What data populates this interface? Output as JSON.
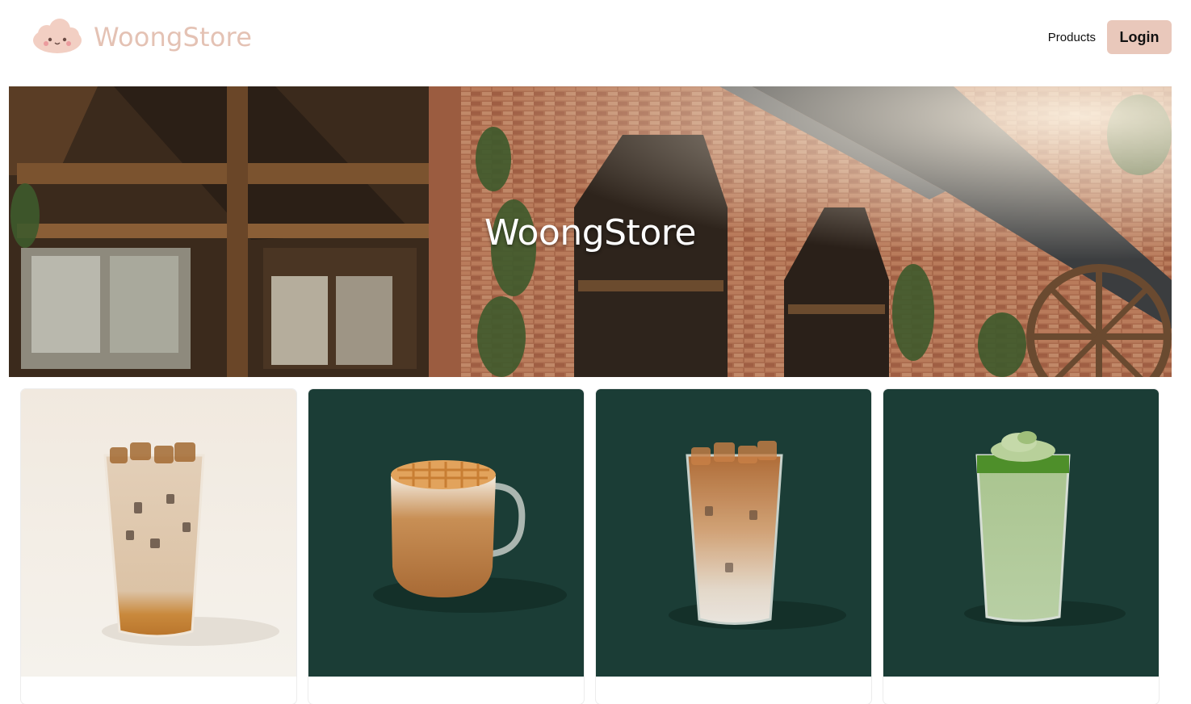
{
  "header": {
    "brand": "WoongStore",
    "nav_products": "Products",
    "login_label": "Login"
  },
  "hero": {
    "title": "WoongStore"
  },
  "products": [
    {
      "image": "iced-latte-photo"
    },
    {
      "image": "caramel-macchiato-photo"
    },
    {
      "image": "iced-caramel-latte-photo"
    },
    {
      "image": "matcha-frappuccino-photo"
    }
  ],
  "colors": {
    "brand": "#e4c2b4",
    "login_bg": "#e9c8bb",
    "card_green": "#1b3d36",
    "card_cream": "#f1ebe4"
  }
}
